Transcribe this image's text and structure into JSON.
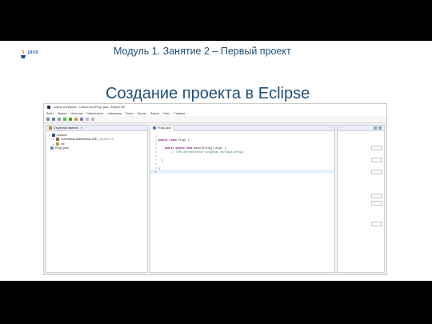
{
  "slide": {
    "logo_text": "java",
    "header_title": "Модуль 1. Занятие 2 – Первый проект",
    "title": "Создание проекта в Eclipse"
  },
  "eclipse": {
    "window_title": "eclipse-workspace - Lesson1/src/Prog1.java - Eclipse IDE",
    "menu": [
      "Файл",
      "Правка",
      "Источник",
      "Рефакторинг",
      "Навигация",
      "Поиск",
      "Проект",
      "Запуск",
      "Окно",
      "Справка"
    ],
    "toolbar_icons": [
      "new-icon",
      "save-icon",
      "print-icon",
      "debug-icon",
      "run-icon",
      "search-icon",
      "open-type-icon",
      "back-icon",
      "forward-icon"
    ],
    "package_explorer": {
      "tab_label": "Структура пакетов",
      "items": [
        {
          "label": "Lesson1",
          "detail": ""
        },
        {
          "label": "Системная библиотека JRE",
          "detail": "[JavaSE-11]"
        },
        {
          "label": "src",
          "detail": ""
        },
        {
          "label": "Prog1.java",
          "detail": ""
        }
      ]
    },
    "editor": {
      "tab_label": "Prog1.java",
      "lines": [
        {
          "n": "1",
          "kw": "",
          "text": ""
        },
        {
          "n": "2",
          "kw": "public class",
          "text": " Prog1 {"
        },
        {
          "n": "3",
          "kw": "",
          "text": ""
        },
        {
          "n": "4",
          "kw": "public static void",
          "text": " main(String[] args) {"
        },
        {
          "n": "5",
          "kw": "",
          "text": "// TODO Автоматически созданная заглушка метода",
          "comment": true
        },
        {
          "n": "6",
          "kw": "",
          "text": ""
        },
        {
          "n": "7",
          "kw": "",
          "text": "  }"
        },
        {
          "n": "8",
          "kw": "",
          "text": ""
        },
        {
          "n": "9",
          "kw": "",
          "text": "}"
        },
        {
          "n": "10",
          "kw": "",
          "text": ""
        }
      ]
    }
  },
  "colors": {
    "title_blue": "#1f4e79",
    "keyword": "#7f0055",
    "comment": "#3f7f5f"
  }
}
